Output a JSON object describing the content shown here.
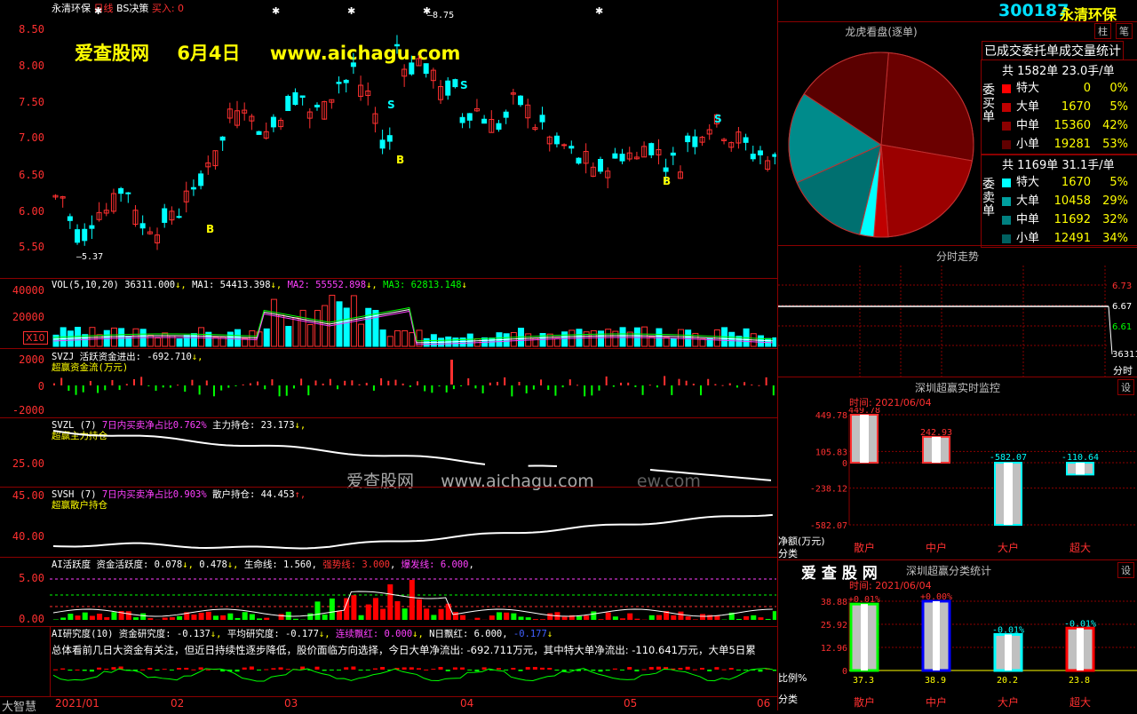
{
  "header": {
    "stock_name": "永清环保",
    "period": "日线",
    "indicator": "BS决策",
    "buy_label": "买入: 0",
    "code": "300187",
    "code_name": "永清环保",
    "btn_1": "柱",
    "btn_2": "笔"
  },
  "watermark": {
    "site": "爱查股网",
    "date": "6月4日",
    "url": "www.aichagu.com",
    "mid_text": "爱查股网",
    "mid_url": "www.aichagu.com",
    "mid_tail": "ew.com"
  },
  "price_chart": {
    "y_ticks": [
      "8.50",
      "8.00",
      "7.50",
      "7.00",
      "6.50",
      "6.00",
      "5.50"
    ],
    "high_label": "8.75",
    "low_label": "5.37",
    "signals": [
      {
        "text": "S",
        "type": "sell"
      },
      {
        "text": "S",
        "type": "sell"
      },
      {
        "text": "S",
        "type": "sell"
      },
      {
        "text": "B",
        "type": "buy"
      },
      {
        "text": "B",
        "type": "buy"
      },
      {
        "text": "B",
        "type": "buy"
      }
    ]
  },
  "vol": {
    "label": "VOL(5,10,20)",
    "value": "36311.000",
    "ma1": "MA1: 54413.398",
    "ma2": "MA2: 55552.898",
    "ma3": "MA3: 62813.148",
    "ticks": [
      "40000",
      "20000"
    ],
    "unit": "X10"
  },
  "svzj": {
    "name": "SVZJ",
    "label": "活跃资金进出: -692.710",
    "sub": "超赢资金流(万元)",
    "ticks": [
      "2000",
      "0",
      "-2000"
    ]
  },
  "svzl": {
    "name": "SVZL (7)",
    "label": "7日内买卖净占比0.762%",
    "label2": "主力持仓: 23.173",
    "sub": "超赢主力持仓",
    "ticks": [
      "25.00"
    ]
  },
  "svsh": {
    "name": "SVSH (7)",
    "label": "7日内买卖净占比0.903%",
    "label2": "散户持仓: 44.453",
    "sub": "超赢散户持仓",
    "ticks": [
      "45.00",
      "40.00"
    ]
  },
  "ai": {
    "name": "AI活跃度",
    "a": "资金活跃度: 0.078",
    "b": "0.478",
    "c": "生命线: 1.560",
    "d": "强势线: 3.000",
    "e": "爆发线: 6.000",
    "ticks": [
      "5.00",
      "0.00"
    ]
  },
  "air": {
    "name": "AI研究度(10)",
    "a": "资金研究度: -0.137",
    "b": "平均研究度: -0.177",
    "c": "连续飘红: 0.000",
    "d": "N日飘红: 6.000",
    "e": "-0.177",
    "comment": "总体看前几日大资金有关注，但近日持续性逐步降低，股价面临方向选择，今日大单净流出: -692.711万元，其中特大单净流出: -110.641万元，大单5日累"
  },
  "x_axis": {
    "labels": [
      "2021/01",
      "02",
      "03",
      "04",
      "05",
      "06"
    ],
    "corner": "大智慧"
  },
  "dragon": {
    "title": "龙虎看盘(逐单)",
    "subtitle": "已成交委托单成交量统计",
    "buy": {
      "side": "委买单",
      "total": "共 1582单 23.0手/单",
      "rows": [
        {
          "name": "特大",
          "count": "0",
          "pct": "0%",
          "color": "#ff0000"
        },
        {
          "name": "大单",
          "count": "1670",
          "pct": "5%",
          "color": "#c00000"
        },
        {
          "name": "中单",
          "count": "15360",
          "pct": "42%",
          "color": "#8b0000"
        },
        {
          "name": "小单",
          "count": "19281",
          "pct": "53%",
          "color": "#600000"
        }
      ]
    },
    "sell": {
      "side": "委卖单",
      "total": "共 1169单 31.1手/单",
      "rows": [
        {
          "name": "特大",
          "count": "1670",
          "pct": "5%",
          "color": "#00ffff"
        },
        {
          "name": "大单",
          "count": "10458",
          "pct": "29%",
          "color": "#00a0a0"
        },
        {
          "name": "中单",
          "count": "11692",
          "pct": "32%",
          "color": "#008080"
        },
        {
          "name": "小单",
          "count": "12491",
          "pct": "34%",
          "color": "#006060"
        }
      ]
    },
    "pie": [
      {
        "label": "买小单",
        "value": 26.5,
        "color": "#6b0000"
      },
      {
        "label": "买中单",
        "value": 21,
        "color": "#9b0000"
      },
      {
        "label": "买大单",
        "value": 2.5,
        "color": "#c00000"
      },
      {
        "label": "卖特大",
        "value": 2.5,
        "color": "#00ffff"
      },
      {
        "label": "卖大单",
        "value": 14.5,
        "color": "#007070"
      },
      {
        "label": "卖中单",
        "value": 16,
        "color": "#008b8b"
      },
      {
        "label": "卖小单",
        "value": 17,
        "color": "#5a0000"
      }
    ]
  },
  "intraday": {
    "title": "分时走势",
    "ticks": [
      "6.73",
      "6.67",
      "6.61"
    ],
    "vol": "36311",
    "fenshi": "分时"
  },
  "monitor": {
    "title": "深圳超赢实时监控",
    "btn": "设",
    "time": "时间: 2021/06/04",
    "y_ticks": [
      "449.78",
      "105.83",
      "0",
      "-238.12",
      "-582.07"
    ],
    "y_caption": "净额(万元)",
    "x_caption": "分类",
    "chart_data": {
      "type": "bar",
      "categories": [
        "散户",
        "中户",
        "大户",
        "超大"
      ],
      "values": [
        449.78,
        242.93,
        -582.07,
        -110.64
      ],
      "labels": [
        "449.78",
        "242.93",
        "-582.07",
        "-110.64"
      ],
      "ylim": [
        -582.07,
        449.78
      ],
      "colors": [
        "#ff3030",
        "#ff3030",
        "#00ffff",
        "#00ffff"
      ]
    }
  },
  "classify": {
    "logo": "爱 查 股 网",
    "title": "深圳超赢分类统计",
    "btn": "设",
    "time": "时间: 2021/06/04",
    "y_ticks": [
      "38.88",
      "25.92",
      "12.96",
      "0"
    ],
    "y_caption": "比例%",
    "x_caption": "分类",
    "chart_data": {
      "type": "bar",
      "categories": [
        "散户",
        "中户",
        "大户",
        "超大"
      ],
      "values": [
        37.3,
        38.9,
        20.2,
        23.8
      ],
      "changes": [
        "+0.01%",
        "+0.00%",
        "-0.01%",
        "-0.01%"
      ],
      "ylim": [
        0,
        38.88
      ],
      "colors": [
        "#00ff00",
        "#0000ff",
        "#00ffff",
        "#ff0000"
      ]
    }
  }
}
